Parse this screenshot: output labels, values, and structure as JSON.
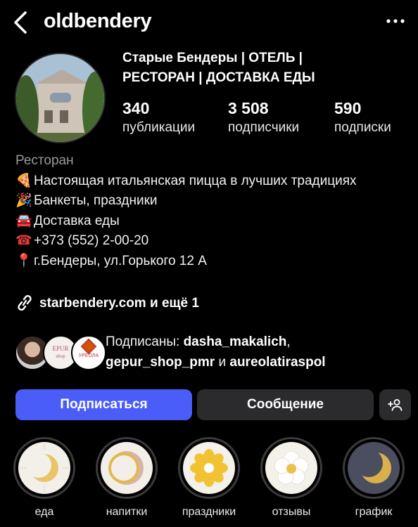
{
  "header": {
    "username": "oldbendery"
  },
  "profile": {
    "display_name": "Старые Бендеры | ОТЕЛЬ | РЕСТОРАН | ДОСТАВКА ЕДЫ",
    "stats": [
      {
        "value": "340",
        "label": "публикации"
      },
      {
        "value": "3 508",
        "label": "подписчики"
      },
      {
        "value": "590",
        "label": "подписки"
      }
    ]
  },
  "bio": {
    "category": "Ресторан",
    "lines": [
      {
        "emoji": "🍕",
        "text": "Настоящая итальянская пицца в лучших традициях"
      },
      {
        "emoji": "🎉",
        "text": "Банкеты, праздники"
      },
      {
        "emoji": "🚘",
        "text": "Доставка еды"
      },
      {
        "emoji": "☎",
        "text": "+373 (552) 2-00-20"
      },
      {
        "emoji": "📍",
        "text": "г.Бендеры, ул.Горького 12 А"
      }
    ],
    "link": "starbendery.com и ещё 1"
  },
  "followed_by": {
    "prefix": "Подписаны: ",
    "user1": "dasha_makalich",
    "sep": ",",
    "user2": "gepur_shop_pmr",
    "conj": " и ",
    "user3": "aureolatiraspol",
    "avatar2_text": "EPUR",
    "avatar2_sub": "shop",
    "avatar3_text": "УРЕОЛА"
  },
  "actions": {
    "follow": "Подписаться",
    "message": "Сообщение"
  },
  "highlights": [
    {
      "label": "еда"
    },
    {
      "label": "напитки"
    },
    {
      "label": "праздники"
    },
    {
      "label": "отзывы"
    },
    {
      "label": "график"
    }
  ],
  "colors": {
    "follow_button": "#4a5df9",
    "secondary_button": "#2b2b2e",
    "background": "#000000",
    "category_text": "#9a9a9a"
  }
}
